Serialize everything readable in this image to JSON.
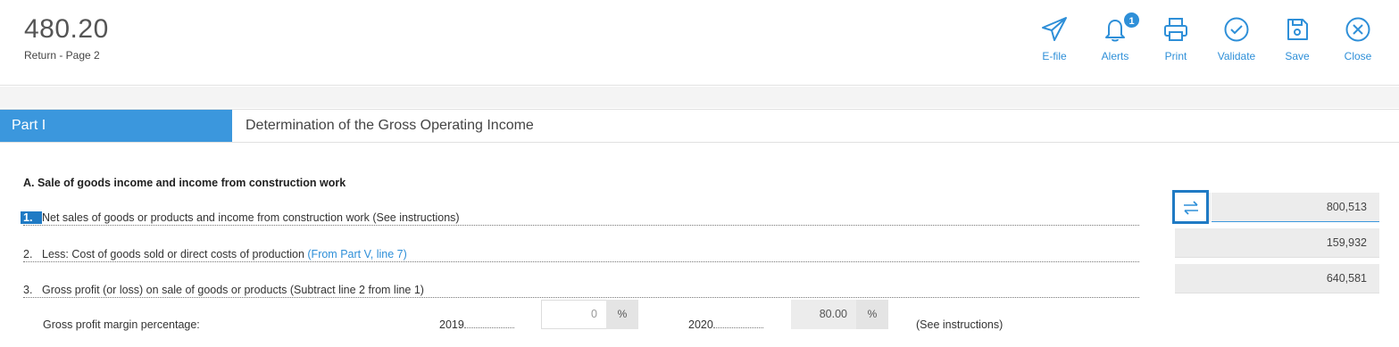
{
  "header": {
    "title": "480.20",
    "subtitle": "Return - Page 2",
    "toolbar": [
      {
        "label": "E-file",
        "icon": "send-icon"
      },
      {
        "label": "Alerts",
        "icon": "bell-icon",
        "badge": "1"
      },
      {
        "label": "Print",
        "icon": "printer-icon"
      },
      {
        "label": "Validate",
        "icon": "check-circle-icon"
      },
      {
        "label": "Save",
        "icon": "save-icon"
      },
      {
        "label": "Close",
        "icon": "close-circle-icon"
      }
    ]
  },
  "part": {
    "label": "Part I",
    "title": "Determination of the Gross Operating Income"
  },
  "section": {
    "heading": "A.  Sale of goods income and income from construction work",
    "lines": [
      {
        "num": "1.",
        "text": "Net sales of goods or products and income from construction work (See instructions)",
        "link": "",
        "value": "800,513"
      },
      {
        "num": "2.",
        "text": "Less: Cost of goods sold or direct costs of production ",
        "link": "(From Part V, line 7)",
        "value": "159,932"
      },
      {
        "num": "3.",
        "text": "Gross profit (or loss) on sale of goods or products (Subtract line 2 from line 1)",
        "link": "",
        "value": "640,581"
      }
    ],
    "margin": {
      "label": "Gross profit margin percentage:",
      "year1": "2019",
      "value1": "0",
      "year2": "2020",
      "value2": "80.00",
      "pct": "%",
      "note": "(See instructions)"
    }
  },
  "colors": {
    "accent": "#3b97dd",
    "active": "#1f7ac4",
    "field_bg": "#ececec"
  }
}
